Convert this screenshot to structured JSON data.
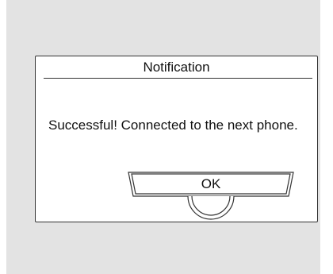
{
  "dialog": {
    "title": "Notification",
    "message": "Successful! Connected to the next phone.",
    "ok_label": "OK"
  },
  "colors": {
    "screen_background": "#e3e3e3",
    "dialog_background": "#ffffff",
    "outline": "#333333"
  }
}
